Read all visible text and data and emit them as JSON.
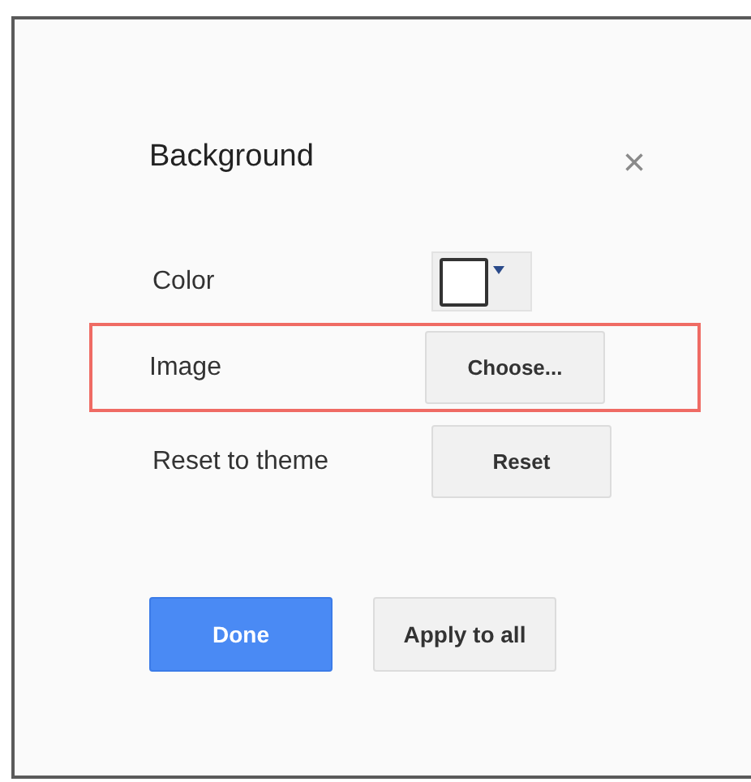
{
  "dialog": {
    "title": "Background",
    "close": "×"
  },
  "rows": [
    {
      "label": "Color",
      "kind": "swatch",
      "highlighted": false
    },
    {
      "label": "Image",
      "kind": "button",
      "button": "Choose...",
      "highlighted": true
    },
    {
      "label": "Reset to theme",
      "kind": "button",
      "button": "Reset",
      "highlighted": false
    }
  ],
  "buttons": [
    {
      "label": "Done",
      "primary": true
    },
    {
      "label": "Apply to all",
      "primary": false
    }
  ]
}
